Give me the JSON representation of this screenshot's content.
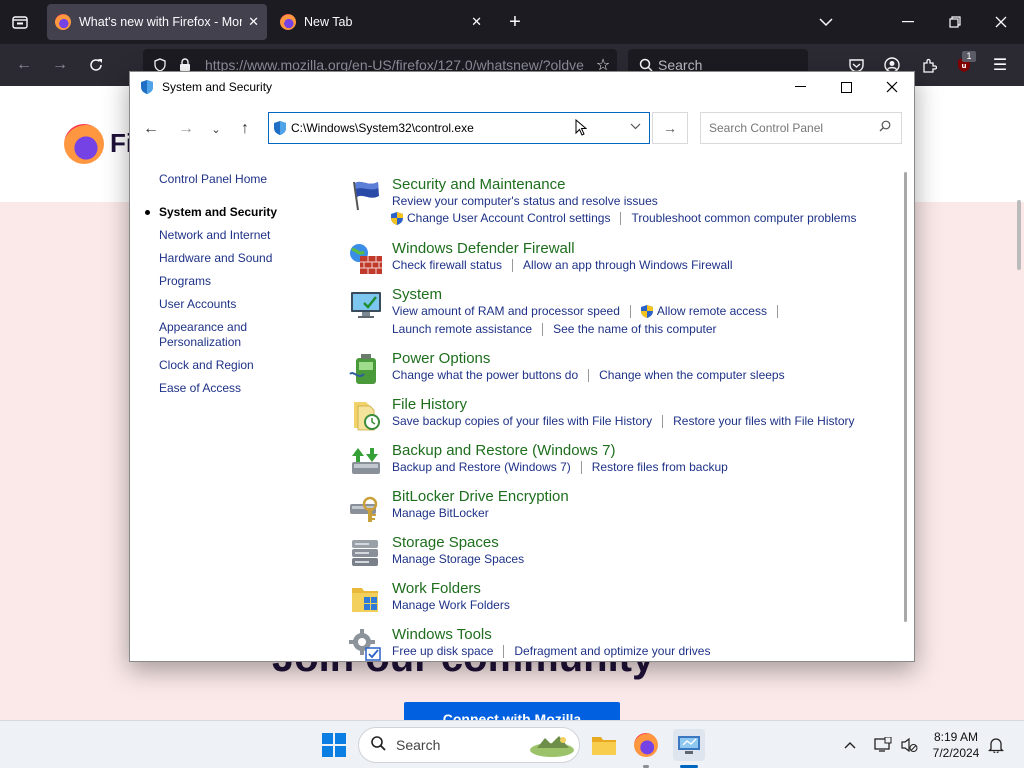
{
  "firefox": {
    "tabs": [
      {
        "title": "What's new with Firefox - More"
      },
      {
        "title": "New Tab"
      }
    ],
    "url": "https://www.mozilla.org/en-US/firefox/127.0/whatsnew/?oldve",
    "search_placeholder": "Search",
    "extension_badge": "1"
  },
  "page": {
    "logo_text": "Fi",
    "heading": "Join our community",
    "cta": "Connect with Mozilla"
  },
  "control_panel": {
    "window_title": "System and Security",
    "address": "C:\\Windows\\System32\\control.exe",
    "search_placeholder": "Search Control Panel",
    "sidebar": {
      "home": "Control Panel Home",
      "items": [
        {
          "label": "System and Security",
          "current": true
        },
        {
          "label": "Network and Internet"
        },
        {
          "label": "Hardware and Sound"
        },
        {
          "label": "Programs"
        },
        {
          "label": "User Accounts"
        },
        {
          "label": "Appearance and Personalization"
        },
        {
          "label": "Clock and Region"
        },
        {
          "label": "Ease of Access"
        }
      ]
    },
    "categories": [
      {
        "title": "Security and Maintenance",
        "icon": "flag-icon",
        "lines": [
          [
            "Review your computer's status and resolve issues"
          ],
          [
            "Change User Account Control settings",
            "Troubleshoot common computer problems"
          ]
        ]
      },
      {
        "title": "Windows Defender Firewall",
        "icon": "firewall-icon",
        "lines": [
          [
            "Check firewall status",
            "Allow an app through Windows Firewall"
          ]
        ]
      },
      {
        "title": "System",
        "icon": "monitor-icon",
        "lines": [
          [
            "View amount of RAM and processor speed",
            "Allow remote access"
          ],
          [
            "Launch remote assistance",
            "See the name of this computer"
          ]
        ]
      },
      {
        "title": "Power Options",
        "icon": "battery-icon",
        "lines": [
          [
            "Change what the power buttons do",
            "Change when the computer sleeps"
          ]
        ]
      },
      {
        "title": "File History",
        "icon": "file-history-icon",
        "lines": [
          [
            "Save backup copies of your files with File History",
            "Restore your files with File History"
          ]
        ]
      },
      {
        "title": "Backup and Restore (Windows 7)",
        "icon": "backup-icon",
        "lines": [
          [
            "Backup and Restore (Windows 7)",
            "Restore files from backup"
          ]
        ]
      },
      {
        "title": "BitLocker Drive Encryption",
        "icon": "bitlocker-icon",
        "lines": [
          [
            "Manage BitLocker"
          ]
        ]
      },
      {
        "title": "Storage Spaces",
        "icon": "storage-icon",
        "lines": [
          [
            "Manage Storage Spaces"
          ]
        ]
      },
      {
        "title": "Work Folders",
        "icon": "work-folders-icon",
        "lines": [
          [
            "Manage Work Folders"
          ]
        ]
      },
      {
        "title": "Windows Tools",
        "icon": "tools-icon",
        "lines": [
          [
            "Free up disk space",
            "Defragment and optimize your drives"
          ]
        ]
      }
    ]
  },
  "taskbar": {
    "search_label": "Search",
    "time": "8:19 AM",
    "date": "7/2/2024"
  },
  "colors": {
    "link": "#1e3287",
    "category_title": "#1e6e1e",
    "accent": "#0067c0"
  }
}
